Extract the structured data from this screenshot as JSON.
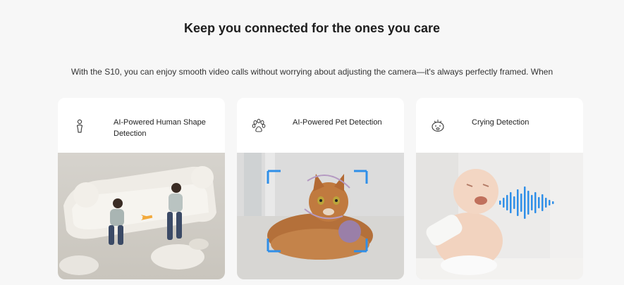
{
  "section": {
    "title": "Keep you connected for the ones you care",
    "description": "With the S10, you can enjoy smooth video calls without worrying about adjusting the camera—it's always perfectly framed. When"
  },
  "features": [
    {
      "label": "AI-Powered Human Shape Detection",
      "icon": "human-shape-icon"
    },
    {
      "label": "AI-Powered Pet Detection",
      "icon": "paw-icon"
    },
    {
      "label": "Crying Detection",
      "icon": "crying-face-icon"
    }
  ],
  "colors": {
    "background": "#f7f7f7",
    "card": "#ffffff",
    "accent_blue": "#2f8fe8",
    "text_dark": "#1d1d1d"
  }
}
